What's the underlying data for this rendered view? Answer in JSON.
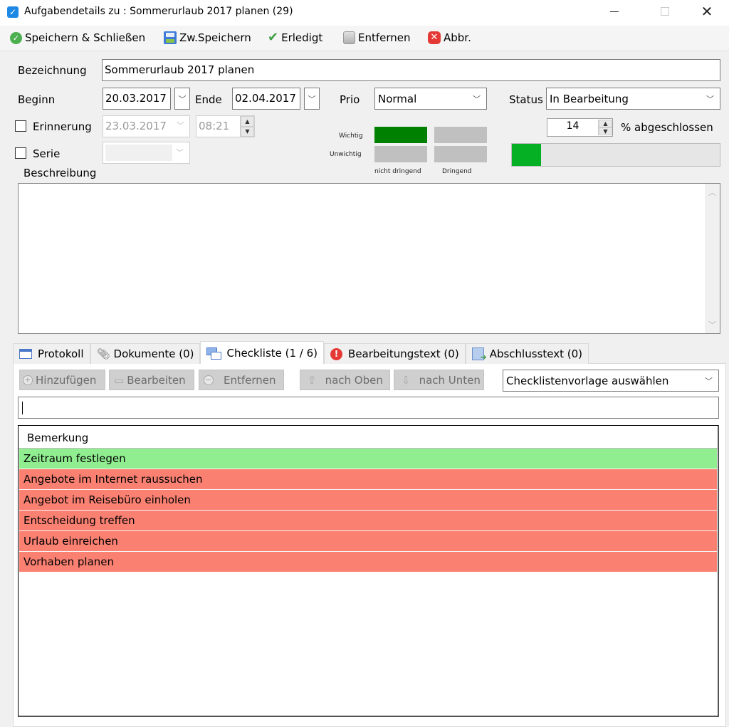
{
  "window": {
    "title": "Aufgabendetails zu : Sommerurlaub 2017 planen (29)",
    "controls": [
      "minimize",
      "maximize",
      "close"
    ]
  },
  "toolbar": {
    "save_close": "Speichern & Schließen",
    "save": "Zw.Speichern",
    "done": "Erledigt",
    "remove": "Entfernen",
    "cancel": "Abbr."
  },
  "form": {
    "bezeichnung_label": "Bezeichnung",
    "bezeichnung_value": "Sommerurlaub 2017 planen",
    "beginn_label": "Beginn",
    "beginn_value": "20.03.2017",
    "ende_label": "Ende",
    "ende_value": "02.04.2017",
    "prio_label": "Prio",
    "prio_value": "Normal",
    "status_label": "Status",
    "status_value": "In Bearbeitung",
    "erinnerung_label": "Erinnerung",
    "erinnerung_checked": false,
    "erinnerung_date": "23.03.2017",
    "erinnerung_time": "08:21",
    "serie_label": "Serie",
    "serie_checked": false,
    "serie_value": "",
    "percent_value": "14",
    "percent_label": "% abgeschlossen",
    "progress_percent": 14,
    "beschreibung_label": "Beschreibung",
    "beschreibung_value": ""
  },
  "matrix": {
    "row_labels": [
      "Wichtig",
      "Unwichtig"
    ],
    "col_labels": [
      "nicht dringend",
      "Dringend"
    ],
    "active_cell": "Wichtig / nicht dringend",
    "active_color": "#008000",
    "inactive_color": "#c0c0c0"
  },
  "tabs": [
    {
      "label": "Protokoll",
      "icon": "table-icon"
    },
    {
      "label": "Dokumente (0)",
      "icon": "paperclip-icon"
    },
    {
      "label": "Checkliste (1 / 6)",
      "icon": "checklist-icon",
      "active": true
    },
    {
      "label": "Bearbeitungstext (0)",
      "icon": "warning-icon"
    },
    {
      "label": "Abschlusstext (0)",
      "icon": "document-arrow-icon"
    }
  ],
  "checklist": {
    "buttons": {
      "add": "Hinzufügen",
      "edit": "Bearbeiten",
      "remove": "Entfernen",
      "up": "nach Oben",
      "down": "nach Unten"
    },
    "template_select": "Checklistenvorlage auswählen",
    "new_item_value": "",
    "column_header": "Bemerkung",
    "done_color": "#90ee90",
    "open_color": "#fa8072",
    "items": [
      {
        "text": "Zeitraum festlegen",
        "done": true
      },
      {
        "text": "Angebote im Internet raussuchen",
        "done": false
      },
      {
        "text": "Angebot im Reisebüro einholen",
        "done": false
      },
      {
        "text": "Entscheidung treffen",
        "done": false
      },
      {
        "text": "Urlaub einreichen",
        "done": false
      },
      {
        "text": "Vorhaben planen",
        "done": false
      }
    ]
  }
}
